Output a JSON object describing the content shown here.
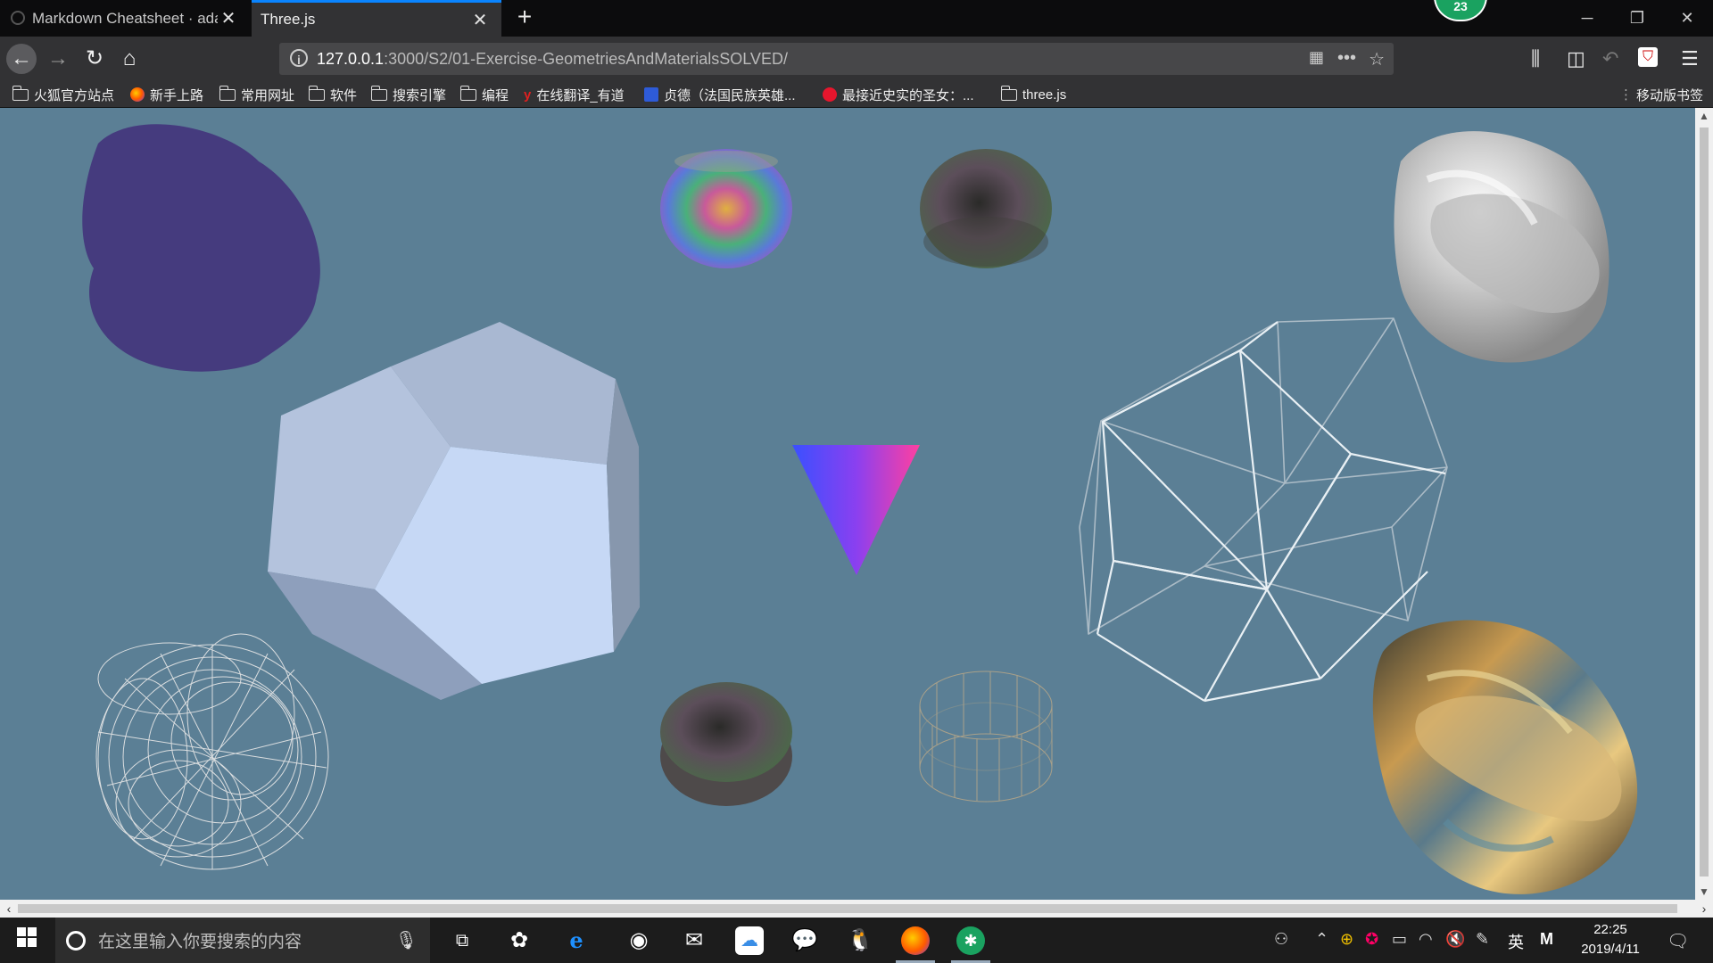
{
  "tabs": [
    {
      "title": "Markdown Cheatsheet · ada",
      "active": false
    },
    {
      "title": "Three.js",
      "active": true
    }
  ],
  "badge_count": "23",
  "url": {
    "host": "127.0.0.1",
    "path": ":3000/S2/01-Exercise-GeometriesAndMaterialsSOLVED/"
  },
  "bookmarks": [
    {
      "label": "火狐官方站点",
      "icon": "folder-icon"
    },
    {
      "label": "新手上路",
      "icon": "firefox-icon"
    },
    {
      "label": "常用网址",
      "icon": "folder-icon"
    },
    {
      "label": "软件",
      "icon": "folder-icon"
    },
    {
      "label": "搜索引擎",
      "icon": "folder-icon"
    },
    {
      "label": "编程",
      "icon": "folder-icon"
    },
    {
      "label": "在线翻译_有道",
      "icon": "youdao-icon"
    },
    {
      "label": "贞德（法国民族英雄...",
      "icon": "baidu-icon"
    },
    {
      "label": "最接近史实的圣女：...",
      "icon": "weibo-icon"
    },
    {
      "label": "three.js",
      "icon": "folder-icon"
    }
  ],
  "mobile_bookmarks": "移动版书签",
  "scene": {
    "background": "#5b7f95",
    "objects": [
      {
        "name": "blob-purple",
        "color": "#453b7e"
      },
      {
        "name": "sphere-rainbow-top",
        "color": "multi"
      },
      {
        "name": "sphere-dark-top",
        "color": "#4a4a44"
      },
      {
        "name": "torusknot-silver",
        "color": "#d9d9d9"
      },
      {
        "name": "dodecahedron-solid",
        "color": "#aabbd8"
      },
      {
        "name": "cone-gradient",
        "color": "#7a46ff"
      },
      {
        "name": "icosahedron-wireframe",
        "color": "#e8eef2"
      },
      {
        "name": "torusknot-wireframe",
        "color": "#e0e0e0"
      },
      {
        "name": "cylinder-dark",
        "color": "#4a4a44"
      },
      {
        "name": "cylinder-wireframe",
        "color": "#b0a890"
      },
      {
        "name": "torusknot-metal",
        "color": "#8a6a3a"
      }
    ]
  },
  "taskbar": {
    "search_placeholder": "在这里输入你要搜索的内容",
    "ime": "英",
    "ime_mode": "M",
    "time": "22:25",
    "date": "2019/4/11"
  }
}
